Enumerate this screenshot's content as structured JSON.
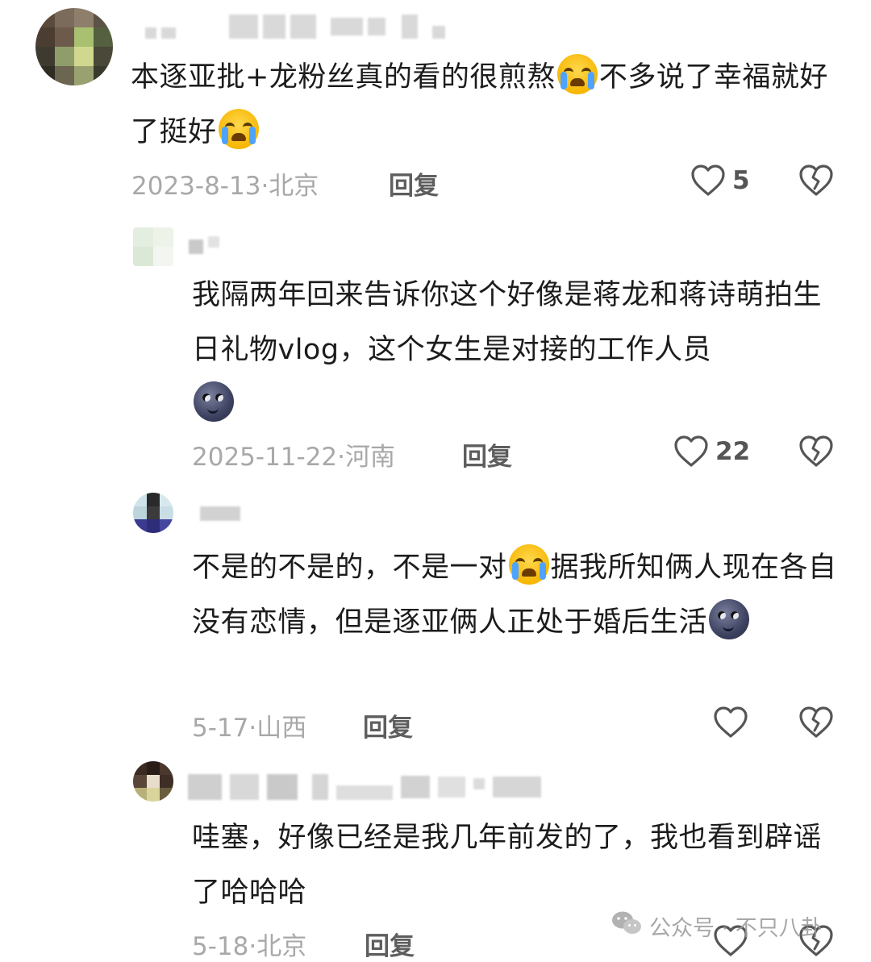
{
  "comments": [
    {
      "text_1": "本逐亚批+龙粉丝真的看的很煎熬",
      "text_2": "不多说了幸福就好了挺好",
      "date": "2023-8-13",
      "location": "北京",
      "reply_label": "回复",
      "likes": "5"
    },
    {
      "text_1": "我隔两年回来告诉你这个好像是蒋龙和蒋诗萌拍生日礼物vlog，这个女生是对接的工作人员",
      "date": "2025-11-22",
      "location": "河南",
      "reply_label": "回复",
      "likes": "22"
    },
    {
      "text_1": "不是的不是的，不是一对",
      "text_2": "据我所知俩人现在各自没有恋情，但是逐亚俩人正处于婚后生活",
      "date": "5-17",
      "location": "山西",
      "reply_label": "回复",
      "likes": ""
    },
    {
      "text_1": "哇塞，好像已经是我几年前发的了，我也看到辟谣了哈哈哈",
      "date": "5-18",
      "location": "北京",
      "reply_label": "回复",
      "likes": ""
    }
  ],
  "watermark": {
    "label": "公众号 · 不只八卦"
  },
  "icons": {
    "like": "heart-outline-icon",
    "dislike": "broken-heart-icon",
    "wechat": "wechat-icon",
    "emoji_cry": "loudly-crying-face-emoji",
    "emoji_moon": "new-moon-face-emoji"
  },
  "colors": {
    "meta": "#a8a8a8",
    "reply": "#5e5e5e",
    "text": "#1c1c1c"
  }
}
